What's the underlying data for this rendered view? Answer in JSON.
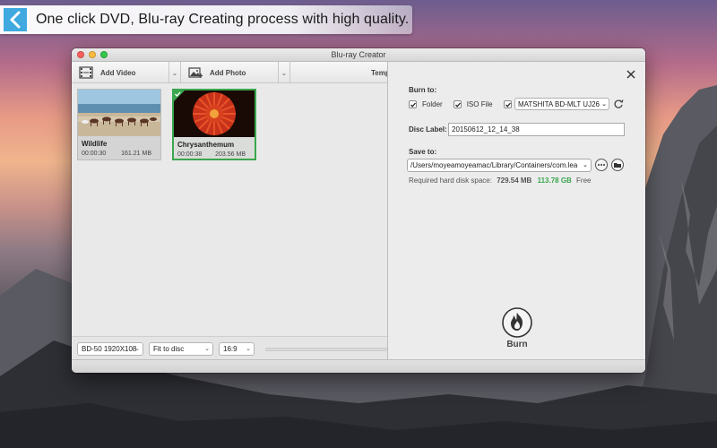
{
  "banner": {
    "text": "One click DVD, Blu-ray Creating process with high quality."
  },
  "window": {
    "title": "Blu-ray Creator"
  },
  "toolbar": {
    "add_video": "Add Video",
    "add_photo": "Add Photo",
    "template": "Temp",
    "dropdown_glyph": "⌄"
  },
  "media": [
    {
      "name": "Wildlife",
      "duration": "00:00:30",
      "size": "161.21 MB",
      "selected": false
    },
    {
      "name": "Chrysanthemum",
      "duration": "00:00:38",
      "size": "203.56 MB",
      "selected": true
    }
  ],
  "bottom": {
    "disc_type": "BD-50 1920X108",
    "fit": "Fit to disc",
    "aspect": "16:9",
    "arrow": "⌄"
  },
  "burn_panel": {
    "burn_to_label": "Burn to:",
    "folder_label": "Folder",
    "folder_checked": true,
    "iso_label": "ISO File",
    "iso_checked": true,
    "drive_checked": true,
    "drive": "MATSHITA BD-MLT UJ26",
    "disc_label_label": "Disc Label:",
    "disc_label_value": "20150612_12_14_38",
    "save_to_label": "Save to:",
    "save_path": "/Users/moyeamoyeamac/Library/Containers/com.lea",
    "required_label": "Required hard disk space:",
    "required_value": "729.54 MB",
    "free_value": "113.78 GB",
    "free_label": "Free",
    "burn_label": "Burn",
    "arrow": "⌄"
  },
  "colors": {
    "accent_green": "#3aa64e",
    "banner_chevron": "#3fa9e0",
    "close_red": "#fc605c",
    "minimize_yellow": "#fdbc40",
    "maximize_green": "#34c84a"
  },
  "icons": [
    "chevron-left-icon",
    "film-icon",
    "photo-icon",
    "close-icon",
    "refresh-icon",
    "more-icon",
    "folder-icon",
    "burn-flame-icon",
    "check-icon"
  ]
}
